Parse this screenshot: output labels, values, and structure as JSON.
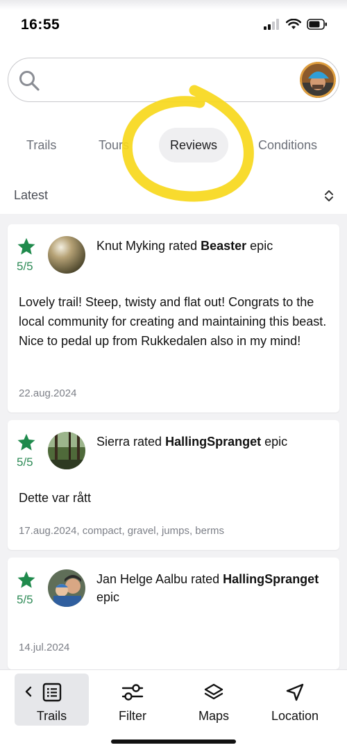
{
  "status_bar": {
    "time": "16:55"
  },
  "search": {
    "placeholder": ""
  },
  "tabs": [
    {
      "label": "Trails"
    },
    {
      "label": "Tours"
    },
    {
      "label": "Reviews",
      "active": true
    },
    {
      "label": "Conditions"
    }
  ],
  "sort": {
    "label": "Latest"
  },
  "reviews": [
    {
      "rating": "5/5",
      "reviewer": "Knut Myking",
      "rated_word": "rated",
      "trail": "Beaster",
      "grade": "epic",
      "body": "Lovely trail! Steep, twisty and flat out! Congrats to the local community for creating and maintaining this beast. Nice to pedal up from Rukkedalen also in my mind!",
      "meta": "22.aug.2024"
    },
    {
      "rating": "5/5",
      "reviewer": "Sierra",
      "rated_word": "rated",
      "trail": "HallingSpranget",
      "grade": "epic",
      "body": "Dette var rått",
      "meta": "17.aug.2024, compact, gravel, jumps, berms"
    },
    {
      "rating": "5/5",
      "reviewer": "Jan Helge Aalbu",
      "rated_word": "rated",
      "trail": "HallingSpranget",
      "grade": "epic",
      "body": "",
      "meta": "14.jul.2024"
    }
  ],
  "bottom_nav": [
    {
      "label": "Trails",
      "icon": "list-icon",
      "active": true
    },
    {
      "label": "Filter",
      "icon": "sliders-icon"
    },
    {
      "label": "Maps",
      "icon": "layers-icon"
    },
    {
      "label": "Location",
      "icon": "navigation-arrow-icon"
    }
  ],
  "colors": {
    "accent_green": "#1f8a4c",
    "highlight_yellow": "#f7d81c",
    "tab_active_bg": "#efeff1",
    "feed_bg": "#f2f2f4"
  }
}
